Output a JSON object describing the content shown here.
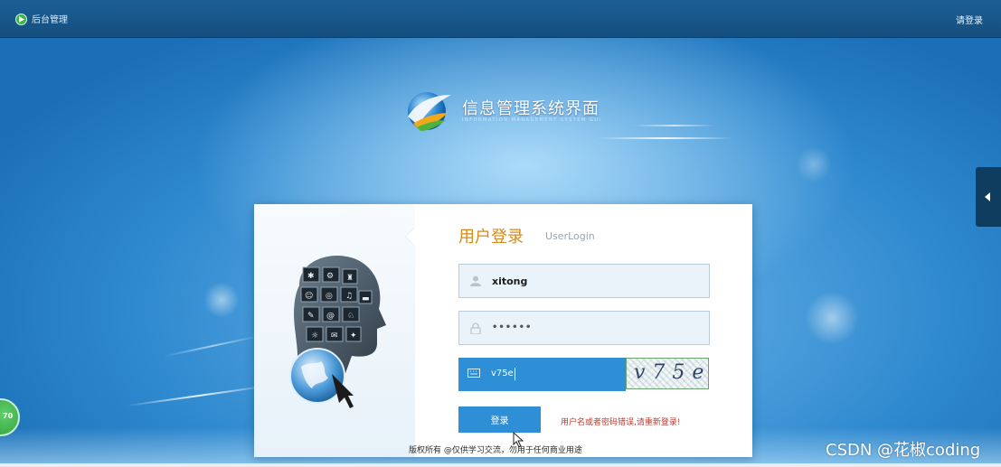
{
  "header": {
    "app_title": "后台管理",
    "login_link": "请登录"
  },
  "brand": {
    "title": "信息管理系统界面",
    "subtitle": "INFORMATION MANAGEMENT SYSTEM GUI"
  },
  "login": {
    "heading": "用户登录",
    "heading_en": "UserLogin",
    "username_value": "xitong",
    "password_value": "••••••",
    "captcha_input_value": "v75e",
    "captcha_code": "v75e",
    "button_label": "登录",
    "error_message": "用户名或者密码错误,请重新登录!"
  },
  "footer": {
    "copyright": "版权所有 @仅供学习交流，勿用于任何商业用途",
    "watermark": "CSDN @花椒coding"
  },
  "badge": {
    "label": "70"
  },
  "colors": {
    "header_bg": "#1c5f95",
    "accent_blue": "#2f8fd6",
    "heading_orange": "#d48a1e",
    "error_red": "#c0392b"
  }
}
